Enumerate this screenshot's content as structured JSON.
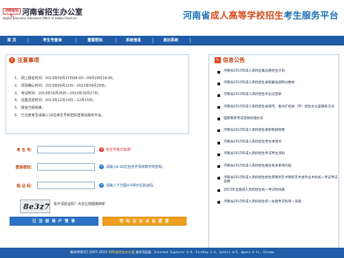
{
  "header": {
    "logo_text": "河南省招生",
    "office_name": "河南省招生办公室",
    "office_name_en": "Higher Education Admission Office of HeNan Province",
    "title_prefix": "河南省",
    "title_accent": "成人高等学校招生",
    "title_suffix": "考生服务平台"
  },
  "nav": {
    "items": [
      {
        "label": "首  页"
      },
      {
        "label": "考生号查询"
      },
      {
        "label": "重置密码"
      },
      {
        "label": "系统信息"
      },
      {
        "label": "退出系统"
      }
    ]
  },
  "notices": {
    "title": "注意事项",
    "items": [
      "1、  网上报名时间：2013年09月17日08:00---09月29日18:00；",
      "2、  现场确认时间：2013年09月22日---2013年09月29日；",
      "3、  考试时间：2013年10月26日---2013年10月27日；",
      "4、  征集志愿时间：2013年12月14日---12月15日；",
      "5、  报名已经结束。",
      "6、  已注册考生请输入16位考生号和密码登录此服务平台。"
    ]
  },
  "announcements": {
    "title": "信息公告",
    "items": [
      "河南省2013年成人高校征集志愿招生计划",
      "河南省2013年成人高校招生录取最低控制分数线",
      "河南省2013年成人高校招生毕业证登录",
      "河南省2013年成人高校招生省辖市、重点扩权县（市）招生办公室联系方式",
      "国家教育考试违规处理办法",
      "河南省2013年成人高校招生录取照顾政策",
      "河南省2013年成人高校招生考生承诺书",
      "河南省2013年成人高校招生考试考生须知",
      "河南省2013年成人高校招生报名有关事项问答",
      "河南省2013年成人高校招生新生需要到艺术院校艺术类专业术科统一考试考试说明",
      "2013年全国成人高校招生统一考试时间表",
      "河南省2013年成人高校招生统一命题考试科目一览表"
    ]
  },
  "form": {
    "exam_no_label": "考 生 号：",
    "exam_no_value": "",
    "exam_no_hint": "考生号格式错误！",
    "password_label": "登录密码：",
    "password_value": "",
    "password_hint": "请输入6-20位包含字母和数字的密码。",
    "captcha_label": "验 证 码：",
    "captcha_value": "",
    "captcha_hint": "请输入下方图片中的5位验证码。",
    "captcha_image_text": "8e3z7",
    "captcha_refresh": "看不清验证码？点击左侧图像刷新",
    "register_button": "已 注 册 用 户 登 录",
    "reset_button": "密 码 忘 记 点 此 重 置"
  },
  "footer": {
    "copyright": "版权所有(C) 2007-2013",
    "owner": "河南省招生办公室",
    "browsers": "推荐浏览器：Internet Explorer 6-9, FireFox 2-4, Safari 4/5, Opera 9-11, Chrome"
  },
  "colors": {
    "nav_blue": "#1f5da8",
    "accent_orange": "#d44a1a",
    "title_blue": "#1a6fb6",
    "button_blue": "#2a72c5",
    "button_orange": "#f0a01e"
  }
}
